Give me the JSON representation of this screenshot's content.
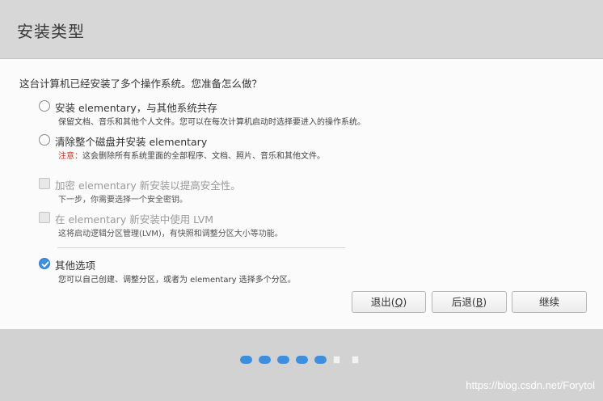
{
  "window": {
    "title": "安装类型"
  },
  "question": "这台计算机已经安装了多个操作系统。您准备怎么做？",
  "options": [
    {
      "label": "安装 elementary，与其他系统共存",
      "desc": "保留文档、音乐和其他个人文件。您可以在每次计算机启动时选择要进入的操作系统。",
      "type": "radio",
      "selected": false,
      "enabled": true
    },
    {
      "label": "清除整个磁盘并安装 elementary",
      "desc_warn": "注意：",
      "desc": "这会删除所有系统里面的全部程序、文档、照片、音乐和其他文件。",
      "type": "radio",
      "selected": false,
      "enabled": true
    },
    {
      "label": "加密 elementary 新安装以提高安全性。",
      "desc": "下一步，你需要选择一个安全密钥。",
      "type": "checkbox",
      "checked": false,
      "enabled": false
    },
    {
      "label": "在 elementary 新安装中使用 LVM",
      "desc": "这将启动逻辑分区管理(LVM)，有快照和调整分区大小等功能。",
      "type": "checkbox",
      "checked": false,
      "enabled": false
    },
    {
      "label": "其他选项",
      "desc": "您可以自己创建、调整分区，或者为 elementary 选择多个分区。",
      "type": "radio",
      "selected": true,
      "enabled": true
    }
  ],
  "buttons": {
    "quit": {
      "text": "退出(",
      "mnemonic": "Q",
      "end": ")"
    },
    "back": {
      "text": "后退(",
      "mnemonic": "B",
      "end": ")"
    },
    "continue": "继续"
  },
  "progress": {
    "total_steps": 7,
    "completed_steps": 5
  },
  "watermark": "https://blog.csdn.net/Forytol",
  "colors": {
    "accent": "#3e8ede",
    "warning": "#c0392b"
  }
}
